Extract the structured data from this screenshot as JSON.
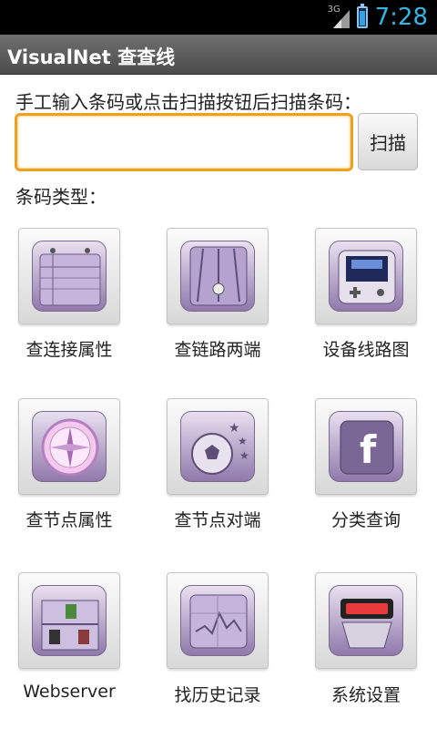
{
  "status": {
    "network": "3G",
    "time": "7:28"
  },
  "app": {
    "title": "VisualNet 查查线"
  },
  "form": {
    "prompt": "手工输入条码或点击扫描按钮后扫描条码：",
    "input_value": "",
    "scan_button": "扫描",
    "type_label": "条码类型："
  },
  "grid": [
    {
      "label": "查连接属性",
      "icon": "notes-icon"
    },
    {
      "label": "查链路两端",
      "icon": "link-ends-icon"
    },
    {
      "label": "设备线路图",
      "icon": "game-device-icon"
    },
    {
      "label": "查节点属性",
      "icon": "compass-icon"
    },
    {
      "label": "查节点对端",
      "icon": "soccer-ball-icon"
    },
    {
      "label": "分类查询",
      "icon": "facebook-icon"
    },
    {
      "label": "Webserver",
      "icon": "shelf-icon"
    },
    {
      "label": "找历史记录",
      "icon": "graph-icon"
    },
    {
      "label": "系统设置",
      "icon": "settings-device-icon"
    }
  ]
}
